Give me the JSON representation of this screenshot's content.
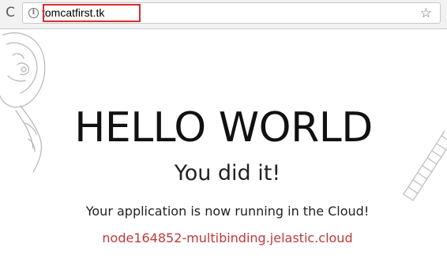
{
  "browser": {
    "reload_glyph": "C",
    "info_glyph": "i",
    "url": "tomcatfirst.tk",
    "star_glyph": "☆",
    "highlight_color": "#d32f2f",
    "icons": [
      "reload-icon",
      "info-icon",
      "bookmark-star-icon"
    ]
  },
  "page": {
    "title": "HELLO WORLD",
    "subtitle": "You did it!",
    "message": "Your application is now running in the Cloud!",
    "node_link": "node164852-multibinding.jelastic.cloud",
    "link_color": "#c2383a"
  }
}
